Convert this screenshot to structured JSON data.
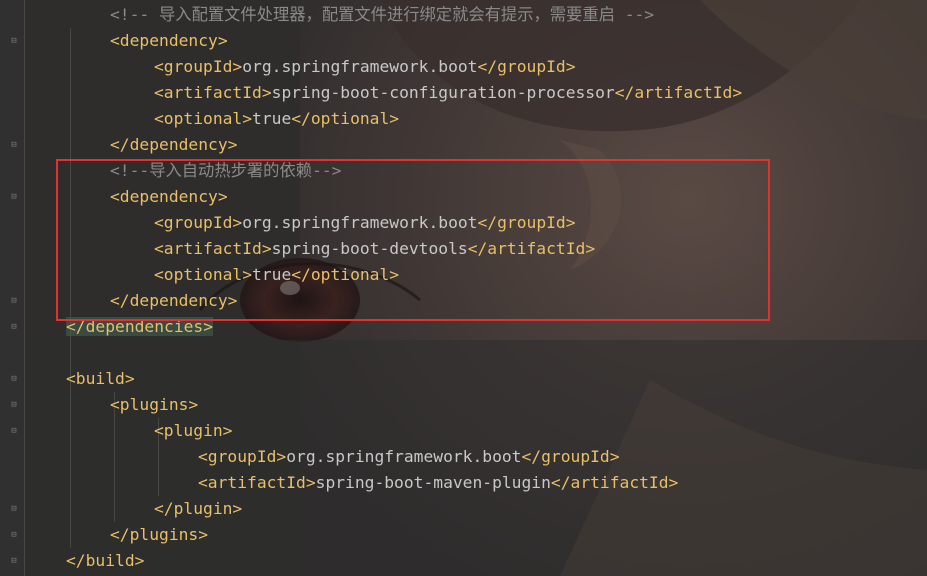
{
  "editor": {
    "lines": [
      {
        "indent": 2,
        "parts": [
          {
            "k": "c",
            "s": "<!-- 导入配置文件处理器，配置文件进行绑定就会有提示，需要重启 -->"
          }
        ]
      },
      {
        "indent": 2,
        "parts": [
          {
            "k": "t",
            "s": "<dependency>"
          }
        ]
      },
      {
        "indent": 3,
        "parts": [
          {
            "k": "t",
            "s": "<groupId>"
          },
          {
            "k": "x",
            "s": "org.springframework.boot"
          },
          {
            "k": "t",
            "s": "</groupId>"
          }
        ]
      },
      {
        "indent": 3,
        "parts": [
          {
            "k": "t",
            "s": "<artifactId>"
          },
          {
            "k": "x",
            "s": "spring-boot-configuration-processor"
          },
          {
            "k": "t",
            "s": "</artifactId>"
          }
        ]
      },
      {
        "indent": 3,
        "parts": [
          {
            "k": "t",
            "s": "<optional>"
          },
          {
            "k": "x",
            "s": "true"
          },
          {
            "k": "t",
            "s": "</optional>"
          }
        ]
      },
      {
        "indent": 2,
        "parts": [
          {
            "k": "t",
            "s": "</dependency>"
          }
        ]
      },
      {
        "indent": 2,
        "parts": [
          {
            "k": "c",
            "s": "<!--导入自动热步署的依赖-->"
          }
        ]
      },
      {
        "indent": 2,
        "parts": [
          {
            "k": "t",
            "s": "<dependency>"
          }
        ]
      },
      {
        "indent": 3,
        "parts": [
          {
            "k": "t",
            "s": "<groupId>"
          },
          {
            "k": "x",
            "s": "org.springframework.boot"
          },
          {
            "k": "t",
            "s": "</groupId>"
          }
        ]
      },
      {
        "indent": 3,
        "parts": [
          {
            "k": "t",
            "s": "<artifactId>"
          },
          {
            "k": "x",
            "s": "spring-boot-devtools"
          },
          {
            "k": "t",
            "s": "</artifactId>"
          }
        ]
      },
      {
        "indent": 3,
        "parts": [
          {
            "k": "t",
            "s": "<optional>"
          },
          {
            "k": "x",
            "s": "true"
          },
          {
            "k": "t",
            "s": "</optional>"
          }
        ]
      },
      {
        "indent": 2,
        "parts": [
          {
            "k": "t",
            "s": "</dependency>"
          }
        ]
      },
      {
        "indent": 1,
        "parts": [
          {
            "k": "t",
            "s": "</dependencies>",
            "hl": true
          }
        ]
      },
      {
        "indent": 0,
        "parts": []
      },
      {
        "indent": 1,
        "parts": [
          {
            "k": "t",
            "s": "<build>"
          }
        ]
      },
      {
        "indent": 2,
        "parts": [
          {
            "k": "t",
            "s": "<plugins>"
          }
        ]
      },
      {
        "indent": 3,
        "parts": [
          {
            "k": "t",
            "s": "<plugin>"
          }
        ]
      },
      {
        "indent": 4,
        "parts": [
          {
            "k": "t",
            "s": "<groupId>"
          },
          {
            "k": "x",
            "s": "org.springframework.boot"
          },
          {
            "k": "t",
            "s": "</groupId>"
          }
        ]
      },
      {
        "indent": 4,
        "parts": [
          {
            "k": "t",
            "s": "<artifactId>"
          },
          {
            "k": "x",
            "s": "spring-boot-maven-plugin"
          },
          {
            "k": "t",
            "s": "</artifactId>"
          }
        ]
      },
      {
        "indent": 3,
        "parts": [
          {
            "k": "t",
            "s": "</plugin>"
          }
        ]
      },
      {
        "indent": 2,
        "parts": [
          {
            "k": "t",
            "s": "</plugins>"
          }
        ]
      },
      {
        "indent": 1,
        "parts": [
          {
            "k": "t",
            "s": "</build>"
          }
        ]
      }
    ],
    "fold_rows": [
      1,
      5,
      7,
      11,
      12,
      14,
      15,
      16,
      19,
      20,
      21
    ],
    "highlight_color": "#e53030"
  }
}
